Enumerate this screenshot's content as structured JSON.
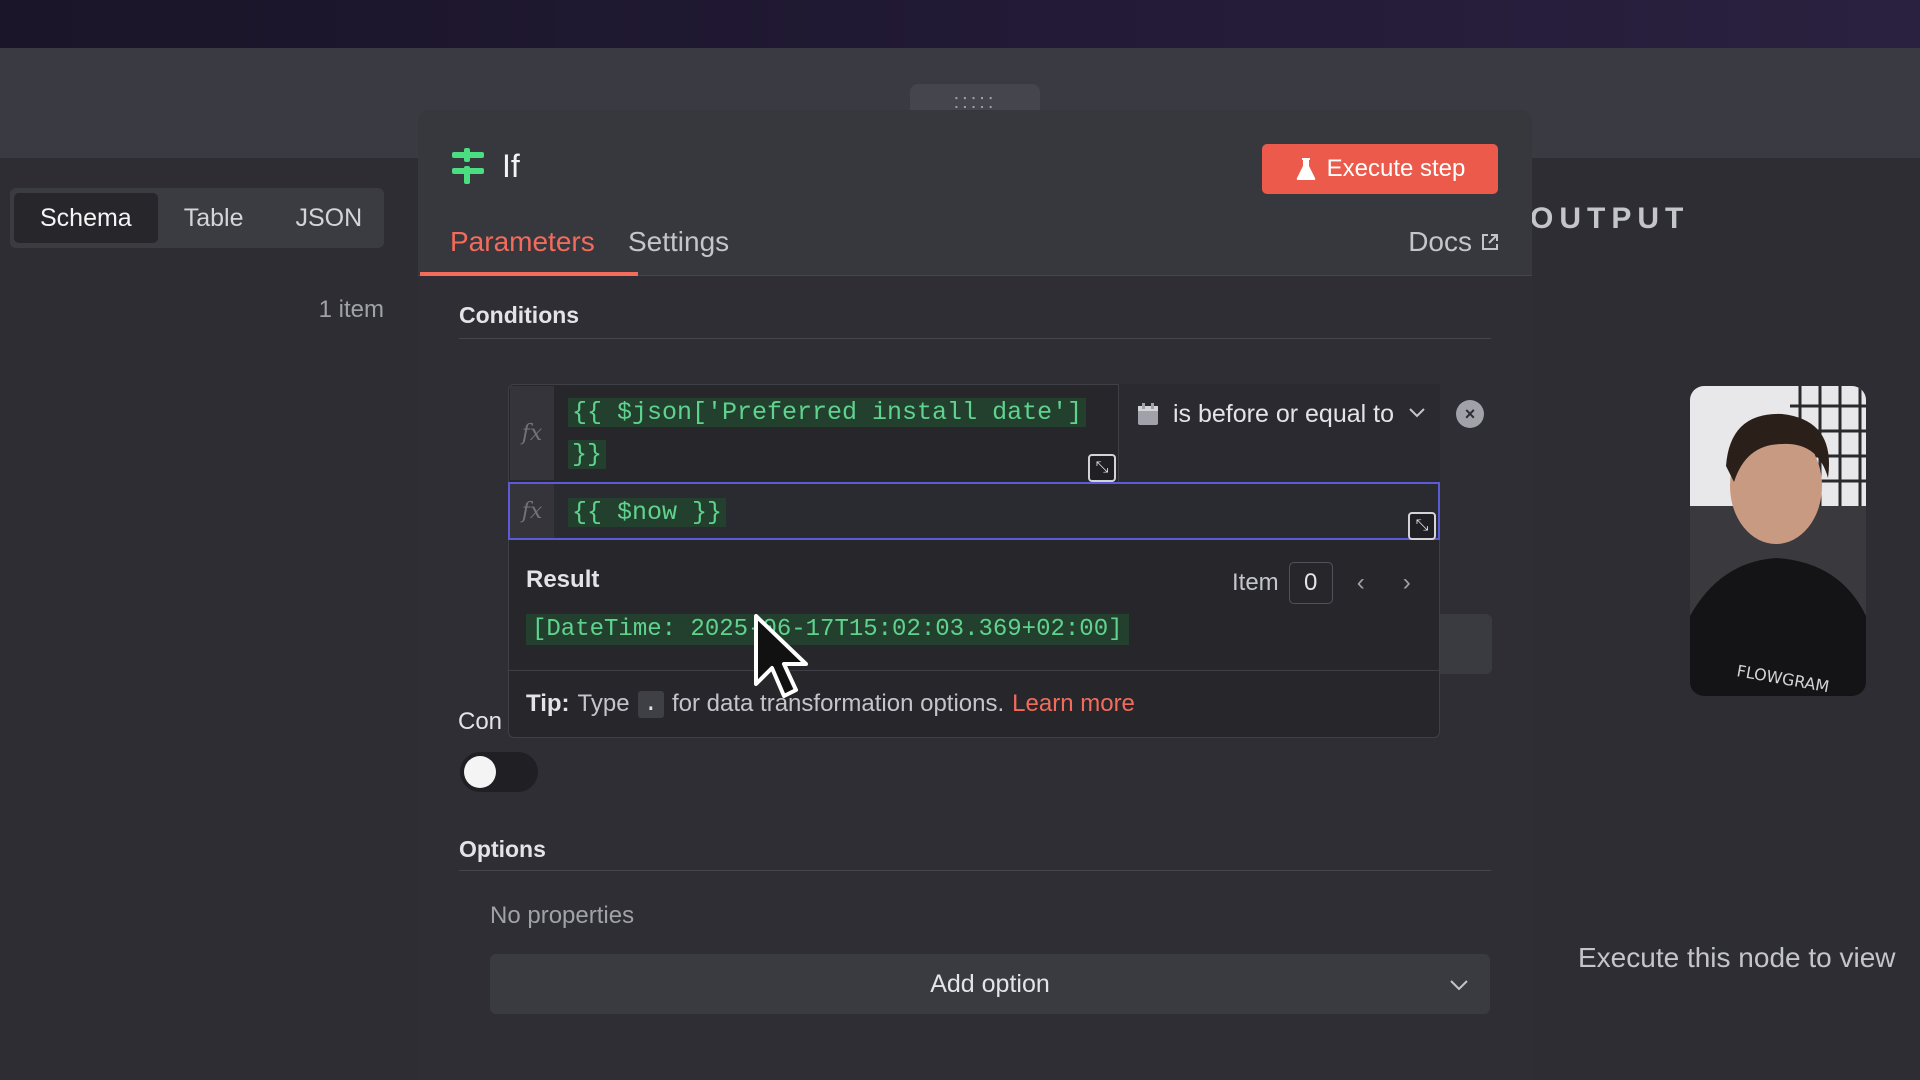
{
  "view_tabs": [
    {
      "label": "Schema",
      "active": true
    },
    {
      "label": "Table",
      "active": false
    },
    {
      "label": "JSON",
      "active": false
    }
  ],
  "input_panel": {
    "item_count": "1 item"
  },
  "output_panel": {
    "title": "OUTPUT",
    "hint": "Execute this node to view"
  },
  "modal": {
    "handle": ":::::",
    "node_title": "If",
    "execute_button": "Execute step",
    "tabs": [
      {
        "label": "Parameters",
        "active": true
      },
      {
        "label": "Settings",
        "active": false
      }
    ],
    "docs_link": "Docs",
    "conditions_title": "Conditions",
    "condition": {
      "left_expr_line1": "{{ $json['Preferred install date']",
      "left_expr_line2": "}}",
      "operator": "is before or equal to",
      "right_expr": "{{ $now }}",
      "fx": "fx"
    },
    "result": {
      "label": "Result",
      "item_label": "Item",
      "item_index": "0",
      "value": "[DateTime: 2025-06-17T15:02:03.369+02:00]"
    },
    "tip": {
      "prefix": "Tip:",
      "text_before": "Type",
      "key": ".",
      "text_after": "for data transformation options.",
      "link": "Learn more"
    },
    "convert_label": "Con",
    "toggle_on": false,
    "options_title": "Options",
    "no_properties": "No properties",
    "add_option": "Add option"
  },
  "colors": {
    "accent": "#f26b5b",
    "execute_button": "#ec5a4b",
    "expression_green": "#5fd38d",
    "focus_border": "#5b5bd6"
  }
}
